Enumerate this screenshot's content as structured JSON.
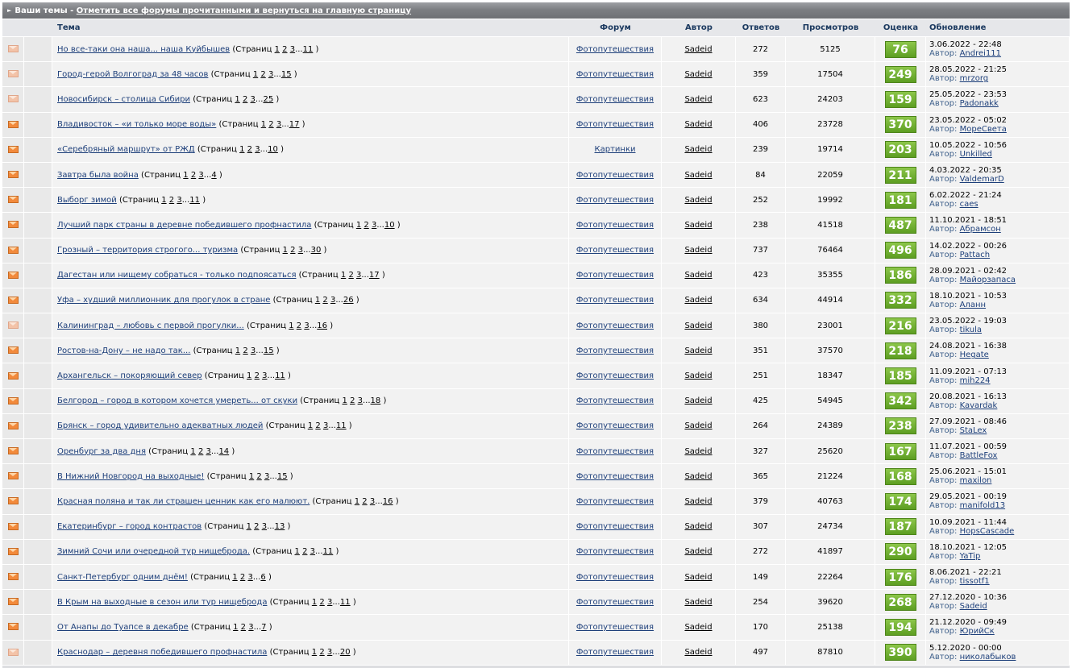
{
  "header": {
    "section_title": "Ваши темы",
    "separator": " - ",
    "mark_read_link": "Отметить все форумы прочитанными и вернуться на главную страницу"
  },
  "columns": {
    "topic": "Тема",
    "forum": "Форум",
    "author": "Автор",
    "replies": "Ответов",
    "views": "Просмотров",
    "rating": "Оценка",
    "updated": "Обновление"
  },
  "labels": {
    "pages_prefix": "(Страниц",
    "ellipsis": "...",
    "close_paren": ")",
    "author_prefix": "Автор:"
  },
  "rows": [
    {
      "title": "Но все-таки она наша... наша Куйбышев",
      "last_page": "11",
      "forum": "Фотопутешествия",
      "author": "Sadeid",
      "replies": "272",
      "views": "5125",
      "rating": "76",
      "updated": "3.06.2022 - 22:48",
      "last_author": "Andrei111",
      "read": true
    },
    {
      "title": "Город-герой Волгоград за 48 часов",
      "last_page": "15",
      "forum": "Фотопутешествия",
      "author": "Sadeid",
      "replies": "359",
      "views": "17504",
      "rating": "249",
      "updated": "28.05.2022 - 21:25",
      "last_author": "mrzorg",
      "read": true
    },
    {
      "title": "Новосибирск – столица Сибири",
      "last_page": "25",
      "forum": "Фотопутешествия",
      "author": "Sadeid",
      "replies": "623",
      "views": "24203",
      "rating": "159",
      "updated": "25.05.2022 - 23:53",
      "last_author": "Padonakk",
      "read": true
    },
    {
      "title": "Владивосток – «и только море воды»",
      "last_page": "17",
      "forum": "Фотопутешествия",
      "author": "Sadeid",
      "replies": "406",
      "views": "23728",
      "rating": "370",
      "updated": "23.05.2022 - 05:02",
      "last_author": "МореСвета",
      "read": false
    },
    {
      "title": "«Серебряный маршрут» от РЖД",
      "last_page": "10",
      "forum": "Картинки",
      "author": "Sadeid",
      "replies": "239",
      "views": "19714",
      "rating": "203",
      "updated": "10.05.2022 - 10:56",
      "last_author": "Unkilled",
      "read": false
    },
    {
      "title": "Завтра была война",
      "last_page": "4",
      "forum": "Фотопутешествия",
      "author": "Sadeid",
      "replies": "84",
      "views": "22059",
      "rating": "211",
      "updated": "4.03.2022 - 20:35",
      "last_author": "ValdemarD",
      "read": false
    },
    {
      "title": "Выборг зимой",
      "last_page": "11",
      "forum": "Фотопутешествия",
      "author": "Sadeid",
      "replies": "252",
      "views": "19992",
      "rating": "181",
      "updated": "6.02.2022 - 21:24",
      "last_author": "caes",
      "read": false
    },
    {
      "title": "Лучший парк страны в деревне победившего профнастила",
      "last_page": "10",
      "forum": "Фотопутешествия",
      "author": "Sadeid",
      "replies": "238",
      "views": "41518",
      "rating": "487",
      "updated": "11.10.2021 - 18:51",
      "last_author": "Абрамсон",
      "read": false
    },
    {
      "title": "Грозный – территория строгого... туризма",
      "last_page": "30",
      "forum": "Фотопутешествия",
      "author": "Sadeid",
      "replies": "737",
      "views": "76464",
      "rating": "496",
      "updated": "14.02.2022 - 00:26",
      "last_author": "Pattach",
      "read": false
    },
    {
      "title": "Дагестан или нищему собраться - только подпоясаться",
      "last_page": "17",
      "forum": "Фотопутешествия",
      "author": "Sadeid",
      "replies": "423",
      "views": "35355",
      "rating": "186",
      "updated": "28.09.2021 - 02:42",
      "last_author": "Майорзапаса",
      "read": false
    },
    {
      "title": "Уфа – худший миллионник для прогулок в стране",
      "last_page": "26",
      "forum": "Фотопутешествия",
      "author": "Sadeid",
      "replies": "634",
      "views": "44914",
      "rating": "332",
      "updated": "18.10.2021 - 10:53",
      "last_author": "Аланн",
      "read": false
    },
    {
      "title": "Калининград – любовь с первой прогулки...",
      "last_page": "16",
      "forum": "Фотопутешествия",
      "author": "Sadeid",
      "replies": "380",
      "views": "23001",
      "rating": "216",
      "updated": "23.05.2022 - 19:03",
      "last_author": "tikula",
      "read": true
    },
    {
      "title": "Ростов-на-Дону – не надо так...",
      "last_page": "15",
      "forum": "Фотопутешествия",
      "author": "Sadeid",
      "replies": "351",
      "views": "37570",
      "rating": "218",
      "updated": "24.08.2021 - 16:38",
      "last_author": "Hegate",
      "read": false
    },
    {
      "title": "Архангельск – покоряющий север",
      "last_page": "11",
      "forum": "Фотопутешествия",
      "author": "Sadeid",
      "replies": "251",
      "views": "18347",
      "rating": "185",
      "updated": "11.09.2021 - 07:13",
      "last_author": "mih224",
      "read": false
    },
    {
      "title": "Белгород – город в котором хочется умереть... от скуки",
      "last_page": "18",
      "forum": "Фотопутешествия",
      "author": "Sadeid",
      "replies": "425",
      "views": "54945",
      "rating": "342",
      "updated": "20.08.2021 - 16:13",
      "last_author": "Kavardak",
      "read": false
    },
    {
      "title": "Брянск – город удивительно адекватных людей",
      "last_page": "11",
      "forum": "Фотопутешествия",
      "author": "Sadeid",
      "replies": "264",
      "views": "24389",
      "rating": "238",
      "updated": "27.09.2021 - 08:46",
      "last_author": "StaLex",
      "read": false
    },
    {
      "title": "Оренбург за два дня",
      "last_page": "14",
      "forum": "Фотопутешествия",
      "author": "Sadeid",
      "replies": "327",
      "views": "25620",
      "rating": "167",
      "updated": "11.07.2021 - 00:59",
      "last_author": "BattleFox",
      "read": false
    },
    {
      "title": "В Нижний Новгород на выходные!",
      "last_page": "15",
      "forum": "Фотопутешествия",
      "author": "Sadeid",
      "replies": "365",
      "views": "21224",
      "rating": "168",
      "updated": "25.06.2021 - 15:01",
      "last_author": "maxilon",
      "read": false
    },
    {
      "title": "Красная поляна и так ли страшен ценник как его малюют.",
      "last_page": "16",
      "forum": "Фотопутешествия",
      "author": "Sadeid",
      "replies": "379",
      "views": "40763",
      "rating": "174",
      "updated": "29.05.2021 - 00:19",
      "last_author": "manifold13",
      "read": false
    },
    {
      "title": "Екатеринбург – город контрастов",
      "last_page": "13",
      "forum": "Фотопутешествия",
      "author": "Sadeid",
      "replies": "307",
      "views": "24734",
      "rating": "187",
      "updated": "10.09.2021 - 11:44",
      "last_author": "HopsCascade",
      "read": false
    },
    {
      "title": "Зимний Сочи или очередной тур нищеброда.",
      "last_page": "11",
      "forum": "Фотопутешествия",
      "author": "Sadeid",
      "replies": "272",
      "views": "41897",
      "rating": "290",
      "updated": "18.10.2021 - 12:05",
      "last_author": "YaTip",
      "read": false
    },
    {
      "title": "Санкт-Петербург одним днём!",
      "last_page": "6",
      "forum": "Фотопутешествия",
      "author": "Sadeid",
      "replies": "149",
      "views": "22264",
      "rating": "176",
      "updated": "8.06.2021 - 22:21",
      "last_author": "tissotf1",
      "read": false
    },
    {
      "title": "В Крым на выходные в сезон или тур нищеброда",
      "last_page": "11",
      "forum": "Фотопутешествия",
      "author": "Sadeid",
      "replies": "254",
      "views": "39620",
      "rating": "268",
      "updated": "27.12.2020 - 10:36",
      "last_author": "Sadeid",
      "read": false
    },
    {
      "title": "От Анапы до Туапсе в декабре",
      "last_page": "7",
      "forum": "Фотопутешествия",
      "author": "Sadeid",
      "replies": "170",
      "views": "25138",
      "rating": "194",
      "updated": "21.12.2020 - 09:49",
      "last_author": "ЮрийСк",
      "read": false
    },
    {
      "title": "Краснодар – деревня победившего профнастила",
      "last_page": "20",
      "forum": "Фотопутешествия",
      "author": "Sadeid",
      "replies": "497",
      "views": "87810",
      "rating": "390",
      "updated": "5.12.2020 - 00:00",
      "last_author": "николабыков",
      "read": true
    }
  ]
}
